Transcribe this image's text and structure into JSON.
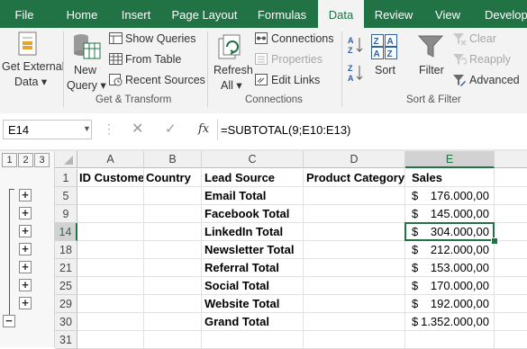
{
  "tabs": [
    "File",
    "Home",
    "Insert",
    "Page Layout",
    "Formulas",
    "Data",
    "Review",
    "View",
    "Develope"
  ],
  "active_tab": "Data",
  "ribbon": {
    "get_transform": {
      "get_external_data": [
        "Get External",
        "Data ▾"
      ],
      "new_query": [
        "New",
        "Query ▾"
      ],
      "show_queries": "Show Queries",
      "from_table": "From Table",
      "recent_sources": "Recent Sources",
      "group_label": "Get & Transform"
    },
    "connections": {
      "refresh_all": [
        "Refresh",
        "All ▾"
      ],
      "connections": "Connections",
      "properties": "Properties",
      "edit_links": "Edit Links",
      "group_label": "Connections"
    },
    "sort_filter": {
      "sort": "Sort",
      "filter": "Filter",
      "clear": "Clear",
      "reapply": "Reapply",
      "advanced": "Advanced",
      "group_label": "Sort & Filter"
    }
  },
  "formula_bar": {
    "name_box": "E14",
    "formula": "=SUBTOTAL(9;E10:E13)",
    "fx": "fx"
  },
  "outline_levels": [
    "1",
    "2",
    "3"
  ],
  "columns": [
    "A",
    "B",
    "C",
    "D",
    "E"
  ],
  "selected_column": "E",
  "header_row": {
    "row": "1",
    "A": "ID Custome",
    "B": "Country",
    "C": "Lead Source",
    "D": "Product Category",
    "E": "Sales"
  },
  "rows": [
    {
      "row": "5",
      "label": " Email Total",
      "currency": "$",
      "value": "176.000,00"
    },
    {
      "row": "9",
      "label": "Facebook Total",
      "currency": "$",
      "value": "145.000,00"
    },
    {
      "row": "14",
      "label": "LinkedIn Total",
      "currency": "$",
      "value": "304.000,00"
    },
    {
      "row": "18",
      "label": "Newsletter Total",
      "currency": "$",
      "value": "212.000,00"
    },
    {
      "row": "21",
      "label": "Referral Total",
      "currency": "$",
      "value": "153.000,00"
    },
    {
      "row": "25",
      "label": "Social Total",
      "currency": "$",
      "value": "170.000,00"
    },
    {
      "row": "29",
      "label": "Website Total",
      "currency": "$",
      "value": "192.000,00"
    },
    {
      "row": "30",
      "label": "Grand Total",
      "currency": "$",
      "value": "1.352.000,00"
    },
    {
      "row": "31",
      "label": "",
      "currency": "",
      "value": ""
    }
  ],
  "selected_row": "14",
  "outline_buttons": [
    "+",
    "+",
    "+",
    "+",
    "+",
    "+",
    "+",
    "−"
  ],
  "colors": {
    "accent": "#217346",
    "ribbon_bg": "#f3f3f3"
  }
}
